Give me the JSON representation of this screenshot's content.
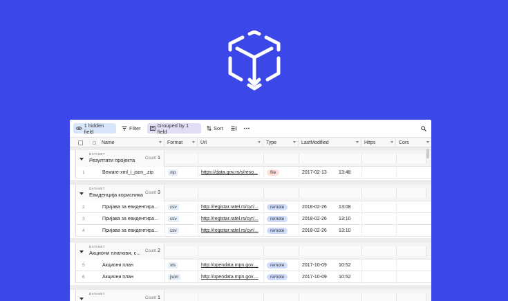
{
  "toolbar": {
    "hidden_fields": "1 hidden field",
    "filter": "Filter",
    "grouped": "Grouped by 1 field",
    "sort": "Sort"
  },
  "columns": [
    "Name",
    "Format",
    "Url",
    "Type",
    "LastModified",
    "Https",
    "Cors"
  ],
  "groups": [
    {
      "dataset_label": "DATASET",
      "title": "Резултати пројекта",
      "count_label": "Count",
      "count": "1",
      "rows": [
        {
          "num": "1",
          "name": "Beware-xml_i_json_.zip",
          "format": "zip",
          "url": "https://data.gov.rs/s/reso...",
          "type": "file",
          "date": "2017-02-13",
          "time": "13:48"
        }
      ]
    },
    {
      "dataset_label": "DATASET",
      "title": "Евиденција корисника",
      "count_label": "Count",
      "count": "3",
      "rows": [
        {
          "num": "2",
          "name": "Пријава за евидентира...",
          "format": "csv",
          "url": "http://registar.ratel.rs/cyr/...",
          "type": "remote",
          "date": "2018-02-26",
          "time": "13:08"
        },
        {
          "num": "3",
          "name": "Пријава за евидентира...",
          "format": "csv",
          "url": "http://registar.ratel.rs/cyr/...",
          "type": "remote",
          "date": "2018-02-26",
          "time": "13:10"
        },
        {
          "num": "4",
          "name": "Пријава за евидентира...",
          "format": "csv",
          "url": "http://registar.ratel.rs/cyr/...",
          "type": "remote",
          "date": "2018-02-26",
          "time": "13:10"
        }
      ]
    },
    {
      "dataset_label": "DATASET",
      "title": "Акциони планови, с...",
      "count_label": "Count",
      "count": "2",
      "rows": [
        {
          "num": "5",
          "name": "Акциони план",
          "format": "xls",
          "url": "http://opendata.mpn.gov....",
          "type": "remote",
          "date": "2017-10-09",
          "time": "10:52"
        },
        {
          "num": "6",
          "name": "Акциони план",
          "format": "json",
          "url": "http://opendata.mpn.gov....",
          "type": "remote",
          "date": "2017-10-09",
          "time": "10:52"
        }
      ]
    },
    {
      "dataset_label": "DATASET",
      "title": "",
      "count_label": "Count",
      "count": "1",
      "rows": []
    }
  ],
  "colors": {
    "background": "#3b47e6",
    "file_tag": "#fde1d8",
    "remote_tag": "#cfdbfb"
  },
  "icons": [
    "cube-logo-icon",
    "eye-icon",
    "filter-icon",
    "group-icon",
    "sort-icon",
    "row-height-icon",
    "more-icon",
    "search-icon"
  ]
}
